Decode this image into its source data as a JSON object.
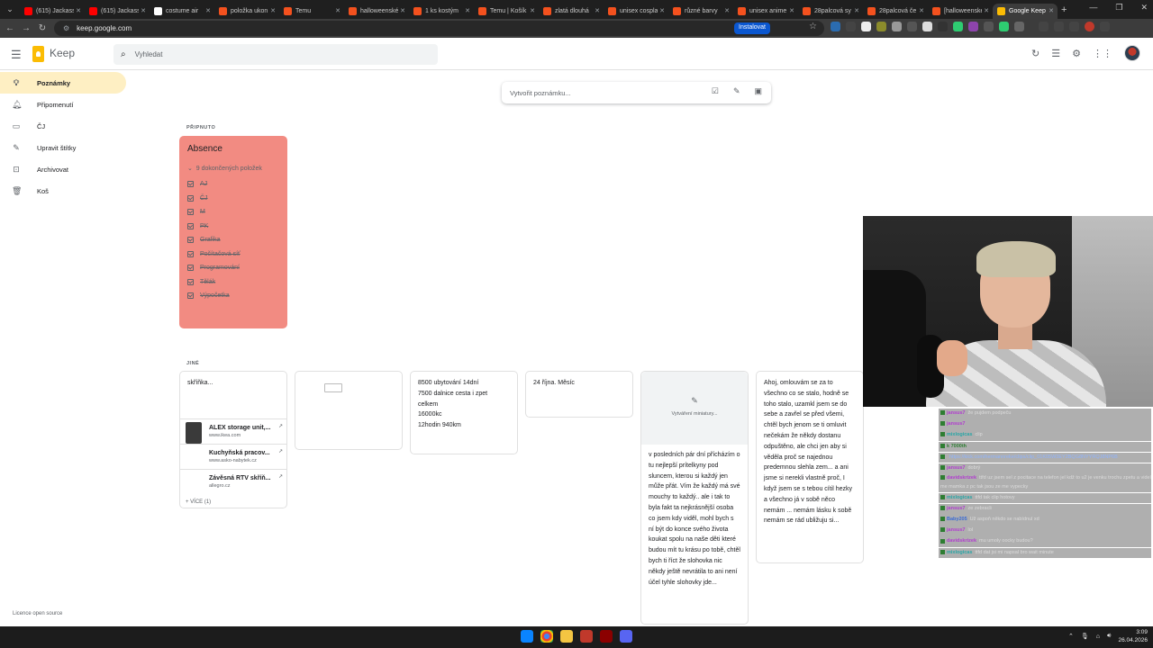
{
  "browser": {
    "tabs": [
      {
        "label": "(615) Jackass",
        "color": "#ff0000"
      },
      {
        "label": "(615) Jackass",
        "color": "#ff0000"
      },
      {
        "label": "costume air",
        "color": "#ffffff"
      },
      {
        "label": "položka ukon",
        "color": "#f4511e"
      },
      {
        "label": "Temu",
        "color": "#f4511e"
      },
      {
        "label": "halloweenské",
        "color": "#f4511e"
      },
      {
        "label": "1 ks kostým",
        "color": "#f4511e"
      },
      {
        "label": "Temu | Košík",
        "color": "#f4511e"
      },
      {
        "label": "zlatá dlouhá",
        "color": "#f4511e"
      },
      {
        "label": "unisex cosplay",
        "color": "#f4511e"
      },
      {
        "label": "různé barvy",
        "color": "#f4511e"
      },
      {
        "label": "unisex anime",
        "color": "#f4511e"
      },
      {
        "label": "28palcová sy",
        "color": "#f4511e"
      },
      {
        "label": "28palcová če",
        "color": "#f4511e"
      },
      {
        "label": "[halloweenské",
        "color": "#f4511e"
      },
      {
        "label": "Google Keep",
        "color": "#fbbc04",
        "active": true
      }
    ],
    "url": "keep.google.com",
    "install_label": "Instalovat"
  },
  "header": {
    "app_name": "Keep",
    "search_placeholder": "Vyhledat"
  },
  "sidebar": {
    "items": [
      {
        "label": "Poznámky",
        "icon": "lightbulb-icon",
        "active": true
      },
      {
        "label": "Připomenutí",
        "icon": "bell-icon"
      },
      {
        "label": "ČJ",
        "icon": "label-icon"
      },
      {
        "label": "Upravit štítky",
        "icon": "pencil-icon"
      },
      {
        "label": "Archivovat",
        "icon": "archive-icon"
      },
      {
        "label": "Koš",
        "icon": "trash-icon"
      }
    ],
    "license": "Licence open source"
  },
  "take_note": {
    "placeholder": "Vytvořit poznámku..."
  },
  "pinned": {
    "section_label": "PŘIPNUTO",
    "note": {
      "title": "Absence",
      "color": "#f28b82",
      "completed_summary": "9 dokončených položek",
      "items": [
        "AJ",
        "ČJ",
        "M",
        "PK",
        "Grafika",
        "Počítačová síť",
        "Programování",
        "Tělák",
        "Výpočetka"
      ]
    }
  },
  "others": {
    "section_label": "JINÉ",
    "link_note": {
      "text": "skříňka...",
      "links": [
        {
          "title": "ALEX storage unit,...",
          "url": "www.ikea.com"
        },
        {
          "title": "Kuchyňská pracov...",
          "url": "www.asko-nabytek.cz"
        },
        {
          "title": "Závěsná RTV skříň...",
          "url": "allegro.cz"
        }
      ],
      "more": "+ VÍCE (1)"
    },
    "travel_note": [
      "8500 ubytování  14dní",
      "7500 dalnice cesta i zpet",
      "celkem",
      "16000kc",
      "12hodin 940km"
    ],
    "date_note": "24 října. Měsíc",
    "image_note": {
      "placeholder": "Vytváření miniatury...",
      "text": "v posledních pár dní přícházím o tu nejlepší  prítelkyny pod sluncem, kterou si každý jen může přát. Vím že každý má své mouchy to každý.. ale i tak to byla fakt ta nejkrásnější osoba co jsem kdy viděl, mohl bych s ní být do konce  svého života koukat spolu na naše děti  které budou mít tu krásu po tobě, chtěl bych ti říct že slohovka nic někdy ještě nevrátila to ani není účel tyhle slohovky  jde..."
    },
    "apology_note": "Ahoj, omlouvám se za to všechno co se stalo, hodně se toho stalo, uzamkl  jsem se do sebe a zavřel se před všemi, chtěl bych jenom se ti omluvit nečekám že někdy dostanu odpuštěno, ale chci jen aby si věděla proč se najednou predemnou slehla zem... a ani jsme si nerekli vlastně proč, I když jsem se s tebou cítil hezky a všechno já v sobě něco nemám ... nemám lásku k sobě nemám se rád ubližuju si..."
  },
  "chat": [
    {
      "name": "jansus7",
      "msg": "že pujdem podpeču",
      "nc": "purple"
    },
    {
      "name": "jansus7",
      "msg": "",
      "nc": "purple"
    },
    {
      "name": "mixlogicas",
      "msg": "clip",
      "nc": "teal"
    },
    {
      "name": "k 7000th",
      "msg": "",
      "nc": "green"
    },
    {
      "name": "",
      "msg": "https://kick.com/hermannreke/clips/clip_01K05W3EY2BQG8NYYRQJ8NP6B",
      "nc": "blue",
      "link": true
    },
    {
      "name": "jansus7",
      "msg": "dobrý",
      "nc": "purple"
    },
    {
      "name": "davidskrizek",
      "msg": "ttfd uz jsem sel z pocitace na telefon jel kdž to u2 je venku trochu zpetu a videl me mamka z pc tak jsou ze me vypecky",
      "nc": "purple",
      "tall": true
    },
    {
      "name": "mixlogicas",
      "msg": "ttfd tak clip hotovy",
      "nc": "teal"
    },
    {
      "name": "jansus7",
      "msg": "ze zebracli",
      "nc": "purple"
    },
    {
      "name": "Baby205",
      "msg": "Už aspoň někdo se nabídnul xd",
      "nc": "blue"
    },
    {
      "name": "jansus7",
      "msg": "lol",
      "nc": "purple"
    },
    {
      "name": "davidskrizek",
      "msg": "mu umoly oocky budou?",
      "nc": "purple"
    },
    {
      "name": "mixlogicas",
      "msg": "ttfd dat jsi mi napsal bro wait minute",
      "nc": "teal"
    }
  ],
  "taskbar": {
    "time": "3:09",
    "date": "26.04.2026"
  }
}
